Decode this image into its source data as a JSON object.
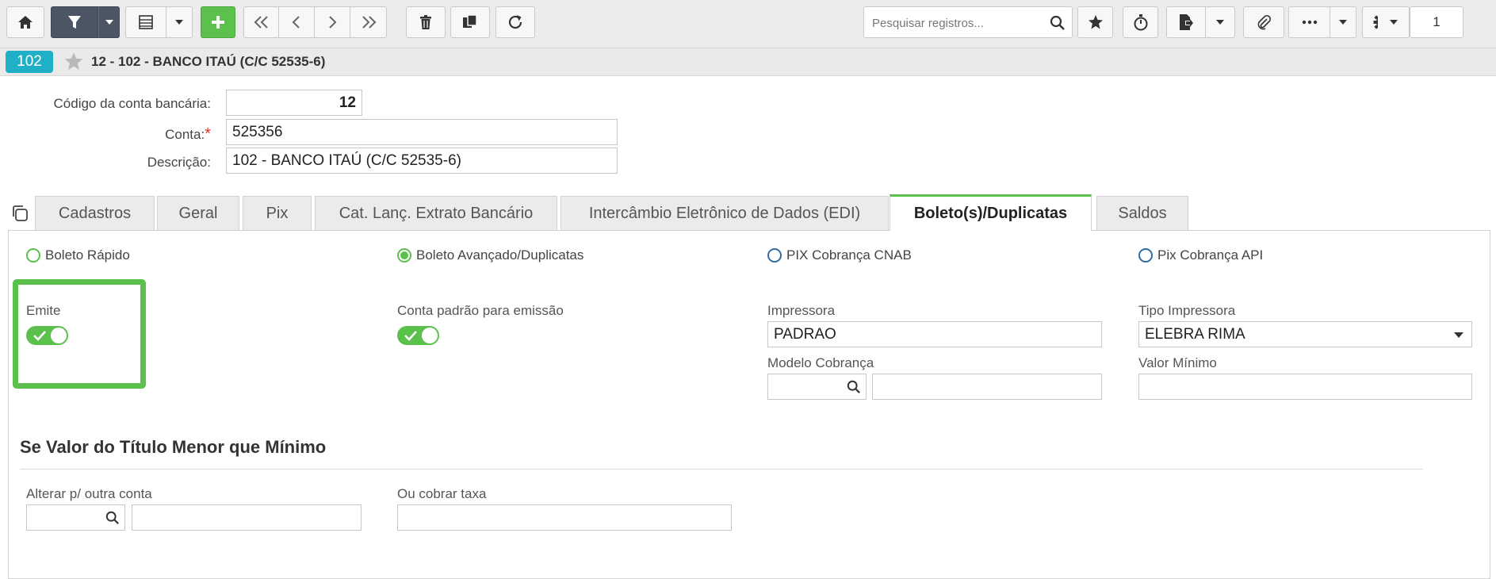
{
  "toolbar": {
    "icons": [
      "home-icon",
      "filter-icon",
      "chevron-down-icon",
      "list-view-icon",
      "chevron-down-icon",
      "plus-icon",
      "first-page-icon",
      "previous-icon",
      "next-icon",
      "last-page-icon",
      "trash-icon",
      "copy-icon",
      "refresh-icon",
      "star-icon",
      "timer-icon",
      "export-icon",
      "chevron-down-icon",
      "attachment-icon",
      "more-icon",
      "chevron-down-icon",
      "gear-icon",
      "chevron-down-icon"
    ],
    "search_placeholder": "Pesquisar registros...",
    "page_number": "1",
    "accent_color": "#5bc14c"
  },
  "record": {
    "badge": "102",
    "title": "12 - 102 - BANCO ITAÚ (C/C 52535-6)",
    "badge_color": "#1fb0c8"
  },
  "header_form": {
    "codigo_label": "Código da conta bancária:",
    "codigo_value": "12",
    "conta_label": "Conta:",
    "conta_required": "*",
    "conta_value": "525356",
    "descricao_label": "Descrição:",
    "descricao_value": "102 - BANCO ITAÚ (C/C 52535-6)"
  },
  "tabs": [
    {
      "label": "Cadastros",
      "active": false
    },
    {
      "label": "Geral",
      "active": false
    },
    {
      "label": "Pix",
      "active": false
    },
    {
      "label": "Cat. Lanç. Extrato Bancário",
      "active": false
    },
    {
      "label": "Intercâmbio Eletrônico de Dados (EDI)",
      "active": false
    },
    {
      "label": "Boleto(s)/Duplicatas",
      "active": true
    },
    {
      "label": "Saldos",
      "active": false
    }
  ],
  "boleto": {
    "radio_options": [
      {
        "label": "Boleto Rápido",
        "selected": false
      },
      {
        "label": "Boleto Avançado/Duplicatas",
        "selected": true
      },
      {
        "label": "PIX Cobrança CNAB",
        "selected": false
      },
      {
        "label": "Pix Cobrança API",
        "selected": false
      }
    ],
    "emite_label": "Emite",
    "emite_on": true,
    "conta_padrao_label": "Conta padrão para emissão",
    "conta_padrao_on": true,
    "impressora_label": "Impressora",
    "impressora_value": "PADRAO",
    "tipo_impressora_label": "Tipo Impressora",
    "tipo_impressora_value": "ELEBRA RIMA",
    "modelo_cobranca_label": "Modelo Cobrança",
    "modelo_cobranca_code": "",
    "modelo_cobranca_desc": "",
    "valor_minimo_label": "Valor Mínimo",
    "valor_minimo_value": ""
  },
  "section_minimo": {
    "title": "Se Valor do Título Menor que Mínimo",
    "alterar_label": "Alterar p/ outra conta",
    "alterar_code": "",
    "alterar_desc": "",
    "taxa_label": "Ou cobrar taxa",
    "taxa_value": ""
  }
}
